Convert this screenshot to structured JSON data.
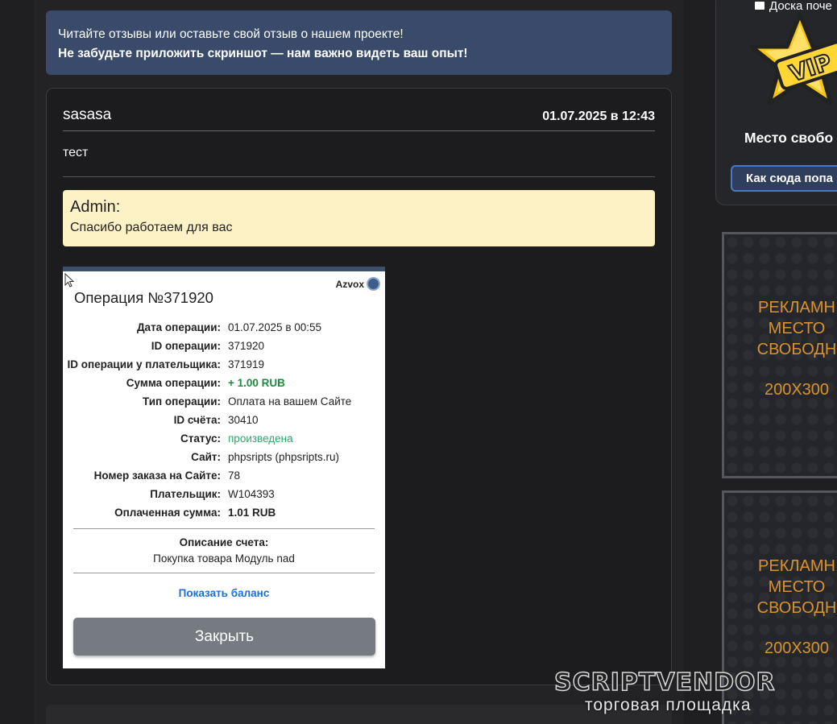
{
  "notice": {
    "line1": "Читайте отзывы или оставьте свой отзыв о нашем проекте!",
    "line2": "Не забудьте приложить скриншот — нам важно видеть ваш опыт!"
  },
  "review": {
    "username": "sasasa",
    "date": "01.07.2025 в 12:43",
    "text": "тест",
    "admin_reply": {
      "title": "Admin:",
      "text": "Спасибо работаем для вас"
    },
    "screenshot": {
      "brand": "Azvox",
      "title": "Операция №371920",
      "rows": [
        {
          "key": "Дата операции:",
          "value": "01.07.2025 в 00:55"
        },
        {
          "key": "ID операции:",
          "value": "371920"
        },
        {
          "key": "ID операции у плательщика:",
          "value": "371919"
        },
        {
          "key": "Сумма операции:",
          "value": "+ 1.00 RUB"
        },
        {
          "key": "Тип операции:",
          "value": "Оплата на вашем Сайте"
        },
        {
          "key": "ID счёта:",
          "value": "30410"
        },
        {
          "key": "Статус:",
          "value": "произведена"
        },
        {
          "key": "Сайт:",
          "value": "phpsripts (phpsripts.ru)"
        },
        {
          "key": "Номер заказа на Сайте:",
          "value": "78"
        },
        {
          "key": "Плательщик:",
          "value": "W104393"
        },
        {
          "key": "Оплаченная сумма:",
          "value": "1.01 RUB"
        }
      ],
      "description_title": "Описание счета:",
      "description_value": "Покупка товара Модуль nad",
      "show_balance": "Показать баланс",
      "close": "Закрыть"
    }
  },
  "sidebar": {
    "board_label": "Доска поче",
    "vip_badge": "VIP",
    "vip_free_text": "Место свобо",
    "vip_button": "Как сюда попа",
    "ads": [
      {
        "text": "РЕКЛАМН\nМЕСТО\nСВОБОДН",
        "size": "200X300"
      },
      {
        "text": "РЕКЛАМН\nМЕСТО\nСВОБОДН",
        "size": "200X300"
      }
    ]
  },
  "watermark": {
    "main": "SCRIPTVENDOR",
    "sub": "торговая площадка"
  },
  "colors": {
    "notice_bg": "#3a4a6b",
    "admin_bg": "#fdf1c6",
    "ad_text": "#d9922e",
    "accent_blue": "#4a78c8",
    "success_green": "#1d8a3e"
  }
}
